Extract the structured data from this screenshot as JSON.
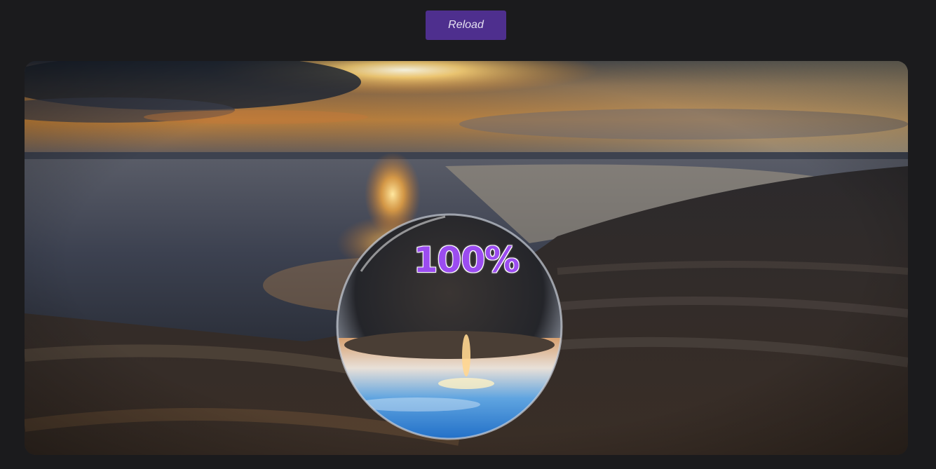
{
  "toolbar": {
    "reload_label": "Reload"
  },
  "preloader": {
    "progress_text": "100%",
    "progress_value": 1.0
  },
  "colors": {
    "background": "#1b1b1d",
    "button_bg": "#4e2f8e",
    "button_text": "#e6e1f2",
    "progress_text": "#9b4cf0"
  }
}
